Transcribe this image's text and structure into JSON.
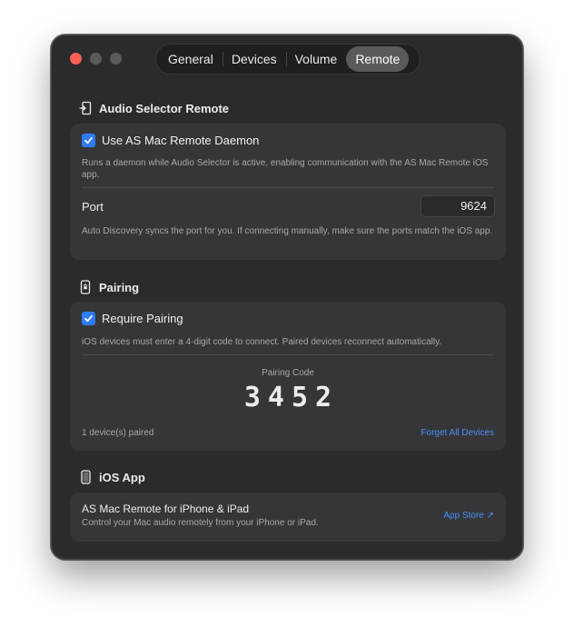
{
  "window": {
    "tabs": [
      {
        "label": "General"
      },
      {
        "label": "Devices"
      },
      {
        "label": "Volume"
      },
      {
        "label": "Remote",
        "active": true
      }
    ]
  },
  "remote_section": {
    "title": "Audio Selector Remote",
    "icon": "door-enter-icon",
    "daemon_checkbox_label": "Use AS Mac Remote Daemon",
    "daemon_checked": true,
    "daemon_description": "Runs a daemon while Audio Selector is active, enabling communication with the AS Mac Remote iOS app.",
    "port_label": "Port",
    "port_value": "9624",
    "port_description": "Auto Discovery syncs the port for you. If connecting manually, make sure the ports match the iOS app."
  },
  "pairing_section": {
    "title": "Pairing",
    "icon": "phone-lock-icon",
    "require_label": "Require Pairing",
    "require_checked": true,
    "require_description": "iOS devices must enter a 4-digit code to connect. Paired devices reconnect automatically.",
    "code_label": "Pairing Code",
    "code": "3452",
    "paired_count": "1 device(s) paired",
    "forget_label": "Forget All Devices"
  },
  "ios_section": {
    "title": "iOS App",
    "icon": "iphone-icon",
    "app_name": "AS Mac Remote for iPhone & iPad",
    "app_description": "Control your Mac audio remotely from your iPhone or iPad.",
    "store_link": "App Store ↗"
  },
  "colors": {
    "accent": "#2f7cf6",
    "link": "#4a8ef7",
    "close": "#fe5f57"
  }
}
